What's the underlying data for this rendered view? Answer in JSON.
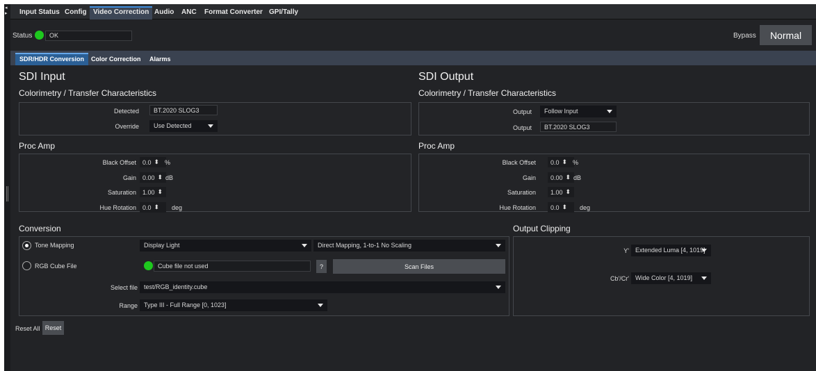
{
  "top_tabs": [
    "Input Status",
    "Config",
    "Video Correction",
    "Audio",
    "ANC",
    "Format Converter",
    "GPI/Tally"
  ],
  "status": {
    "label": "Status",
    "value": "OK",
    "led_color": "#1ec81e"
  },
  "bypass": {
    "label": "Bypass",
    "button": "Normal"
  },
  "sub_tabs": [
    "SDR/HDR Conversion",
    "Color Correction",
    "Alarms"
  ],
  "sdi_input": {
    "title": "SDI Input",
    "colorimetry_title": "Colorimetry / Transfer Characteristics",
    "detected_label": "Detected",
    "detected_value": "BT.2020 SLOG3",
    "override_label": "Override",
    "override_value": "Use Detected",
    "procamp_title": "Proc Amp",
    "procamp": [
      {
        "label": "Black Offset",
        "value": "0.0",
        "unit": "%"
      },
      {
        "label": "Gain",
        "value": "0.00",
        "unit": "dB"
      },
      {
        "label": "Saturation",
        "value": "1.00",
        "unit": ""
      },
      {
        "label": "Hue Rotation",
        "value": "0.0",
        "unit": "deg"
      }
    ]
  },
  "sdi_output": {
    "title": "SDI Output",
    "colorimetry_title": "Colorimetry / Transfer Characteristics",
    "output_select_label": "Output",
    "output_select_value": "Follow Input",
    "output_label": "Output",
    "output_value": "BT.2020 SLOG3",
    "procamp_title": "Proc Amp",
    "procamp": [
      {
        "label": "Black Offset",
        "value": "0.0",
        "unit": "%"
      },
      {
        "label": "Gain",
        "value": "0.00",
        "unit": "dB"
      },
      {
        "label": "Saturation",
        "value": "1.00",
        "unit": ""
      },
      {
        "label": "Hue Rotation",
        "value": "0.0",
        "unit": "deg"
      }
    ]
  },
  "conversion": {
    "title": "Conversion",
    "tone_mapping_label": "Tone Mapping",
    "tone_mapping_selected": true,
    "tone_mapping_mode": "Display Light",
    "tone_mapping_method": "Direct Mapping, 1-to-1 No Scaling",
    "rgb_cube_label": "RGB Cube File",
    "rgb_cube_selected": false,
    "cube_status": "Cube file not used",
    "help_label": "?",
    "scan_label": "Scan Files",
    "select_file_label": "Select file",
    "select_file_value": "test/RGB_identity.cube",
    "range_label": "Range",
    "range_value": "Type III - Full Range [0, 1023]"
  },
  "output_clipping": {
    "title": "Output Clipping",
    "y_label": "Y'",
    "y_value": "Extended Luma [4, 1019]",
    "cbcr_label": "Cb'/Cr'",
    "cbcr_value": "Wide Color [4, 1019]"
  },
  "reset": {
    "label": "Reset All",
    "button": "Reset"
  }
}
